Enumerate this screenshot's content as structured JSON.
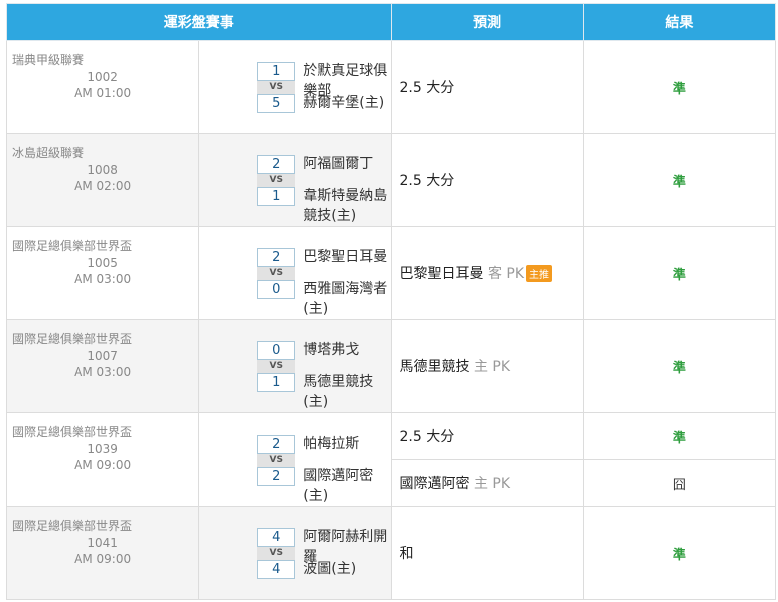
{
  "header": {
    "col_match": "運彩盤賽事",
    "col_prediction": "預測",
    "col_result": "結果"
  },
  "rows": [
    {
      "league": "瑞典甲級聯賽",
      "number": "1002",
      "time": "AM 01:00",
      "team1": "於默真足球俱樂部",
      "score1": "1",
      "vs": "VS",
      "team2": "赫爾辛堡(主)",
      "score2": "5",
      "predictions": [
        {
          "main": "2.5 大分",
          "side": "",
          "badge": "",
          "result": "準",
          "result_type": "win"
        }
      ]
    },
    {
      "league": "冰島超級聯賽",
      "number": "1008",
      "time": "AM 02:00",
      "team1": "阿福圖爾丁",
      "score1": "2",
      "vs": "VS",
      "team2": "韋斯特曼納島競技(主)",
      "score2": "1",
      "predictions": [
        {
          "main": "2.5 大分",
          "side": "",
          "badge": "",
          "result": "準",
          "result_type": "win"
        }
      ]
    },
    {
      "league": "國際足總俱樂部世界盃",
      "number": "1005",
      "time": "AM 03:00",
      "team1": "巴黎聖日耳曼",
      "score1": "2",
      "vs": "VS",
      "team2": "西雅圖海灣者(主)",
      "score2": "0",
      "predictions": [
        {
          "main": "巴黎聖日耳曼",
          "side": "客 PK",
          "badge": "主推",
          "result": "準",
          "result_type": "win"
        }
      ]
    },
    {
      "league": "國際足總俱樂部世界盃",
      "number": "1007",
      "time": "AM 03:00",
      "team1": "博塔弗戈",
      "score1": "0",
      "vs": "VS",
      "team2": "馬德里競技(主)",
      "score2": "1",
      "predictions": [
        {
          "main": "馬德里競技",
          "side": "主 PK",
          "badge": "",
          "result": "準",
          "result_type": "win"
        }
      ]
    },
    {
      "league": "國際足總俱樂部世界盃",
      "number": "1039",
      "time": "AM 09:00",
      "team1": "帕梅拉斯",
      "score1": "2",
      "vs": "VS",
      "team2": "國際邁阿密(主)",
      "score2": "2",
      "predictions": [
        {
          "main": "2.5 大分",
          "side": "",
          "badge": "",
          "result": "準",
          "result_type": "win"
        },
        {
          "main": "國際邁阿密",
          "side": "主 PK",
          "badge": "",
          "result": "囧",
          "result_type": "lose"
        }
      ]
    },
    {
      "league": "國際足總俱樂部世界盃",
      "number": "1041",
      "time": "AM 09:00",
      "team1": "阿爾阿赫利開羅",
      "score1": "4",
      "vs": "VS",
      "team2": "波圖(主)",
      "score2": "4",
      "predictions": [
        {
          "main": "和",
          "side": "",
          "badge": "",
          "result": "準",
          "result_type": "win"
        }
      ]
    }
  ],
  "colors": {
    "header_bg": "#2ea7e0",
    "win": "#2f9e3e",
    "badge": "#f39a1f"
  }
}
